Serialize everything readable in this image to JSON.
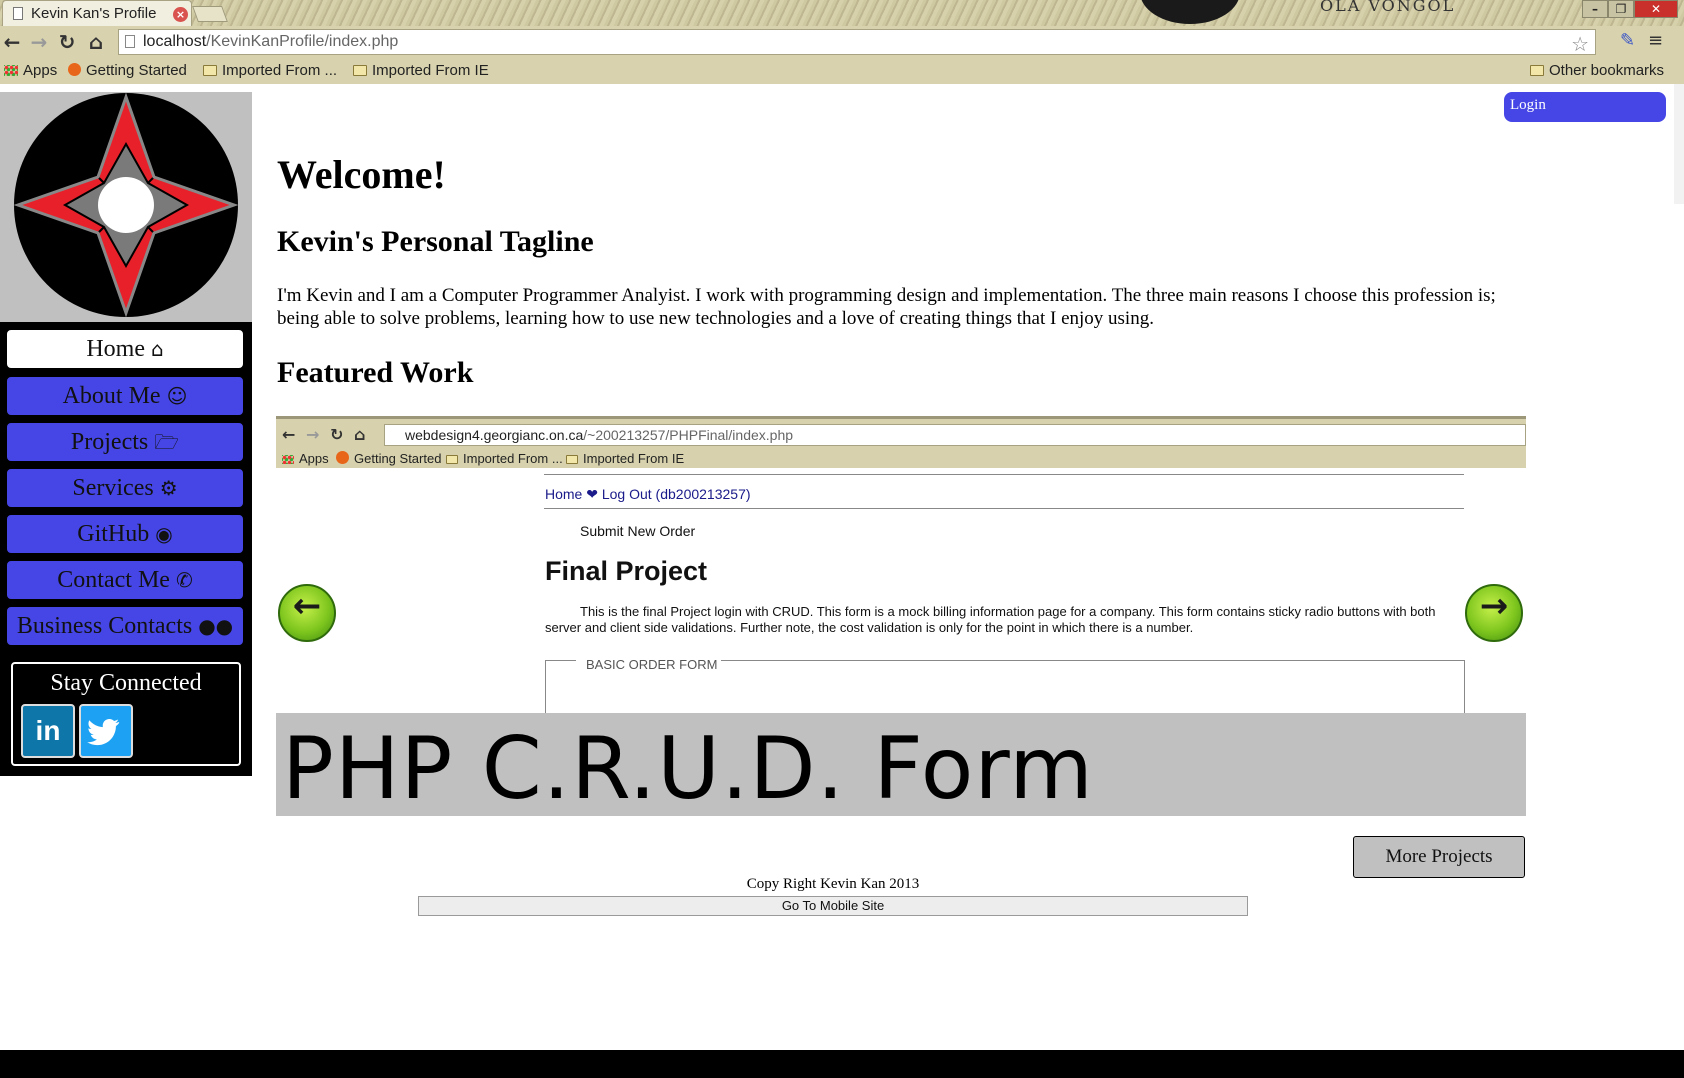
{
  "browser": {
    "tab_title": "Kevin Kan's Profile",
    "tab_close": "×",
    "decor_text": "OLA VONGOL",
    "window_controls": {
      "minimize": "–",
      "restore": "❐",
      "close": "✕"
    },
    "url_host": "localhost",
    "url_path": "/KevinKanProfile/index.php",
    "nav": {
      "back": "←",
      "forward": "→",
      "reload": "↻",
      "home": "⌂"
    },
    "star": "☆",
    "menu": "≡",
    "bookmarks": [
      {
        "label": "Apps",
        "icon": "apps-icon"
      },
      {
        "label": "Getting Started",
        "icon": "firefox-icon"
      },
      {
        "label": "Imported From ...",
        "icon": "folder-icon"
      },
      {
        "label": "Imported From IE",
        "icon": "folder-icon"
      }
    ],
    "other_bookmarks": "Other bookmarks"
  },
  "sidebar": {
    "nav": [
      {
        "label": "Home",
        "icon": "⌂",
        "icon_name": "home-icon",
        "active": true
      },
      {
        "label": "About Me",
        "icon": "☺",
        "icon_name": "smile-icon",
        "active": false
      },
      {
        "label": "Projects",
        "icon": "🗁",
        "icon_name": "folder-open-icon",
        "active": false
      },
      {
        "label": "Services",
        "icon": "⚙",
        "icon_name": "gears-icon",
        "active": false
      },
      {
        "label": "GitHub",
        "icon": "◉",
        "icon_name": "github-icon",
        "active": false
      },
      {
        "label": "Contact Me",
        "icon": "✆",
        "icon_name": "phone-icon",
        "active": false
      },
      {
        "label": "Business Contacts",
        "icon": "●●",
        "icon_name": "users-icon",
        "active": false
      }
    ],
    "stay_connected": "Stay Connected",
    "linkedin": "in"
  },
  "header": {
    "login": "Login"
  },
  "main": {
    "welcome": "Welcome!",
    "tagline_heading": "Kevin's Personal Tagline",
    "bio": "I'm Kevin and I am a Computer Programmer Analyist. I work with programming design and implementation. The three main reasons I choose this profession is; being able to solve problems, learning how to use new technologies and a love of creating things that I enjoy using.",
    "featured_heading": "Featured Work",
    "featured": {
      "url_host": "webdesign4.georgianc.on.ca",
      "url_path": "/~200213257/PHPFinal/index.php",
      "bookmarks": [
        "Apps",
        "Getting Started",
        "Imported From ...",
        "Imported From IE"
      ],
      "links": "Home ❤ Log Out (db200213257)",
      "submit_link": "Submit New Order",
      "title": "Final Project",
      "description": "This is the final Project login with CRUD. This form is a mock billing information page for a company. This form contains sticky radio buttons with both server and client side validations. Further note, the cost validation is only for the point in which there is a number.",
      "legend": "BASIC ORDER FORM",
      "caption": "PHP C.R.U.D. Form",
      "prev": "←",
      "next": "→"
    },
    "more_projects": "More Projects"
  },
  "footer": {
    "copyright": "Copy Right Kevin Kan 2013",
    "mobile": "Go To Mobile Site"
  },
  "colors": {
    "nav_blue": "#4646e6",
    "logo_red": "#e8202a",
    "logo_gray": "#7a7a7a"
  }
}
